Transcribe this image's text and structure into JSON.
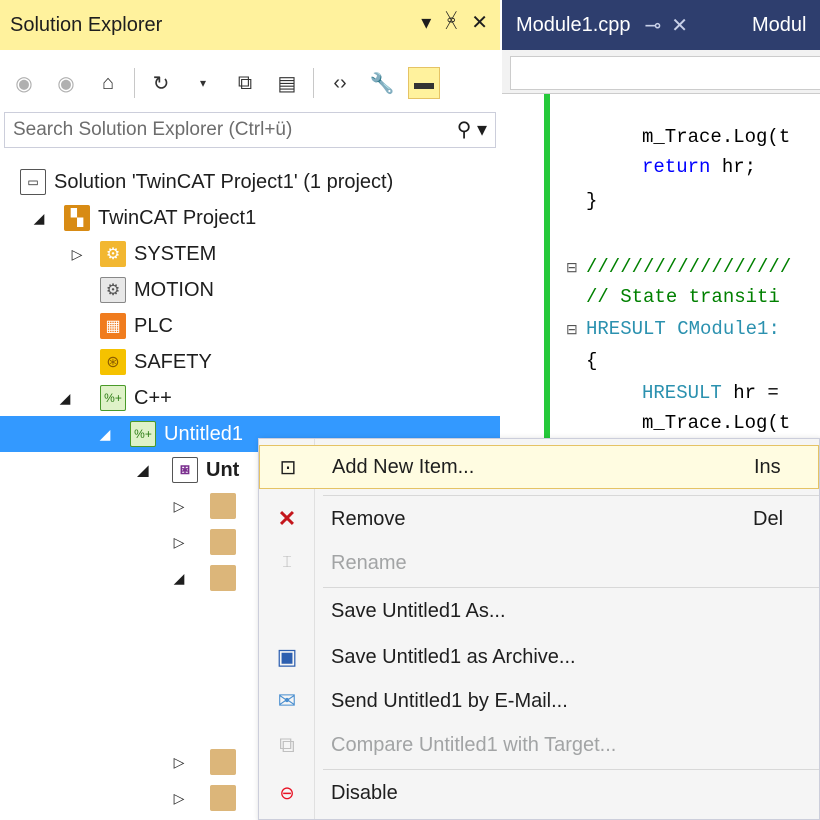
{
  "solution_explorer": {
    "title": "Solution Explorer",
    "search_placeholder": "Search Solution Explorer (Ctrl+ü)",
    "tree": {
      "solution": "Solution 'TwinCAT Project1' (1 project)",
      "project": "TwinCAT Project1",
      "system": "SYSTEM",
      "motion": "MOTION",
      "plc": "PLC",
      "safety": "SAFETY",
      "cpp": "C++",
      "untitled1": "Untitled1",
      "untitled_child": "Unt"
    }
  },
  "editor": {
    "tabs": [
      "Module1.cpp",
      "Modul"
    ],
    "code": {
      "l1": "m_Trace.Log(t",
      "l2_kw": "return",
      "l2_rest": " hr;",
      "l3": "}",
      "l4": "//////////////////",
      "l5": "// State transiti",
      "l6_ty": "HRESULT",
      "l6_rest": " CModule1:",
      "l7": "{",
      "l8_ty": "HRESULT",
      "l8_rest": " hr =",
      "l9": "m_Trace.Log(t"
    }
  },
  "context_menu": {
    "items": [
      {
        "label": "Add New Item...",
        "shortcut": "Ins",
        "icon": "add-new-item-icon"
      },
      {
        "label": "Remove",
        "shortcut": "Del",
        "icon": "remove-icon"
      },
      {
        "label": "Rename",
        "shortcut": "",
        "icon": "rename-icon"
      },
      {
        "label": "Save Untitled1 As...",
        "shortcut": "",
        "icon": ""
      },
      {
        "label": "Save Untitled1 as Archive...",
        "shortcut": "",
        "icon": "archive-icon"
      },
      {
        "label": "Send Untitled1 by E-Mail...",
        "shortcut": "",
        "icon": "email-icon"
      },
      {
        "label": "Compare Untitled1 with Target...",
        "shortcut": "",
        "icon": "compare-icon"
      },
      {
        "label": "Disable",
        "shortcut": "",
        "icon": "disable-icon"
      }
    ]
  },
  "colors": {
    "title_bar": "#fff29d",
    "selection": "#3399ff",
    "editor_tabs": "#2e3e6e",
    "change_margin": "#25c93a"
  }
}
